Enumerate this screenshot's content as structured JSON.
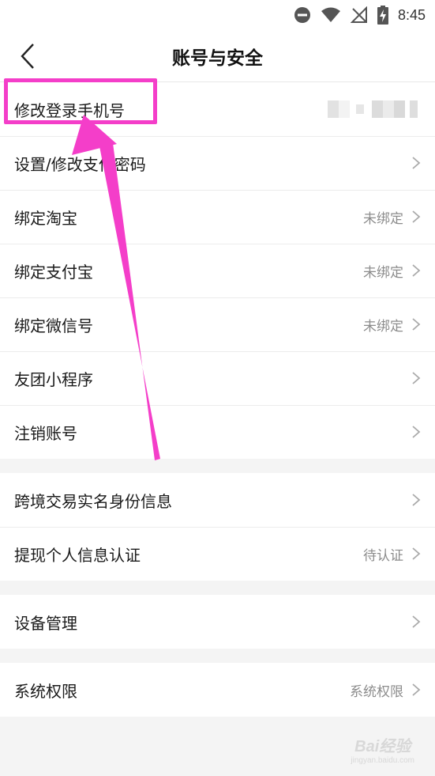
{
  "status_bar": {
    "time": "8:45"
  },
  "header": {
    "title": "账号与安全"
  },
  "groups": [
    {
      "items": [
        {
          "label": "修改登录手机号",
          "value": ""
        },
        {
          "label": "设置/修改支付密码",
          "value": ""
        },
        {
          "label": "绑定淘宝",
          "value": "未绑定"
        },
        {
          "label": "绑定支付宝",
          "value": "未绑定"
        },
        {
          "label": "绑定微信号",
          "value": "未绑定"
        },
        {
          "label": "友团小程序",
          "value": ""
        },
        {
          "label": "注销账号",
          "value": ""
        }
      ]
    },
    {
      "items": [
        {
          "label": "跨境交易实名身份信息",
          "value": ""
        },
        {
          "label": "提现个人信息认证",
          "value": "待认证"
        }
      ]
    },
    {
      "items": [
        {
          "label": "设备管理",
          "value": ""
        }
      ]
    },
    {
      "items": [
        {
          "label": "系统权限",
          "value": "系统权限"
        }
      ]
    }
  ],
  "colors": {
    "annotation": "#f43ec9",
    "separator": "#f4f4f4"
  },
  "watermark": {
    "main": "Bai经验",
    "sub": "jingyan.baidu.com"
  }
}
